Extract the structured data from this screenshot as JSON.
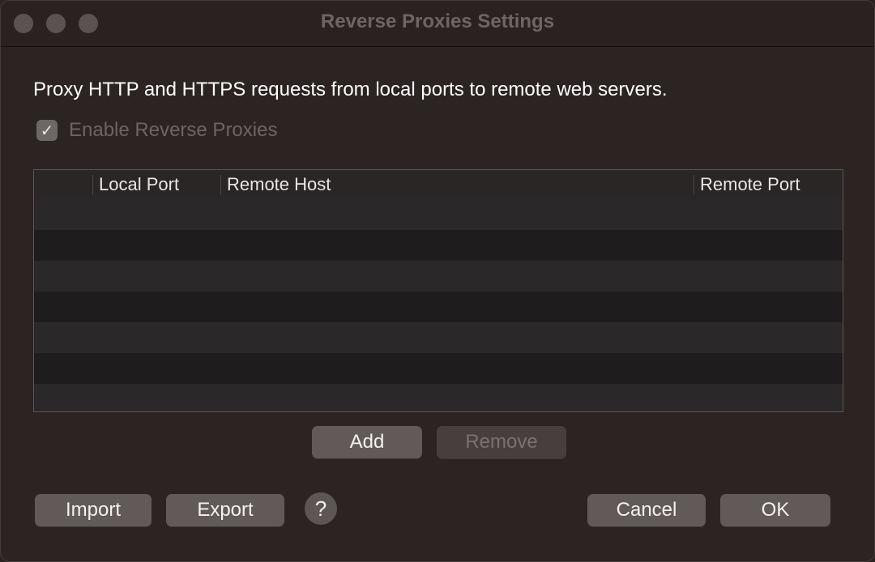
{
  "window": {
    "title": "Reverse Proxies Settings"
  },
  "description": "Proxy HTTP and HTTPS requests from local ports to remote web servers.",
  "enable_checkbox": {
    "label": "Enable Reverse Proxies",
    "checked": true
  },
  "table": {
    "columns": [
      "",
      "Local Port",
      "Remote Host",
      "Remote Port"
    ],
    "rows": []
  },
  "buttons": {
    "add": "Add",
    "remove": "Remove",
    "import": "Import",
    "export": "Export",
    "help": "?",
    "cancel": "Cancel",
    "ok": "OK"
  },
  "colors": {
    "window_bg": "#2c2423",
    "button_bg": "#615a59",
    "text_primary": "#ffffff",
    "text_disabled": "#6d6564"
  }
}
